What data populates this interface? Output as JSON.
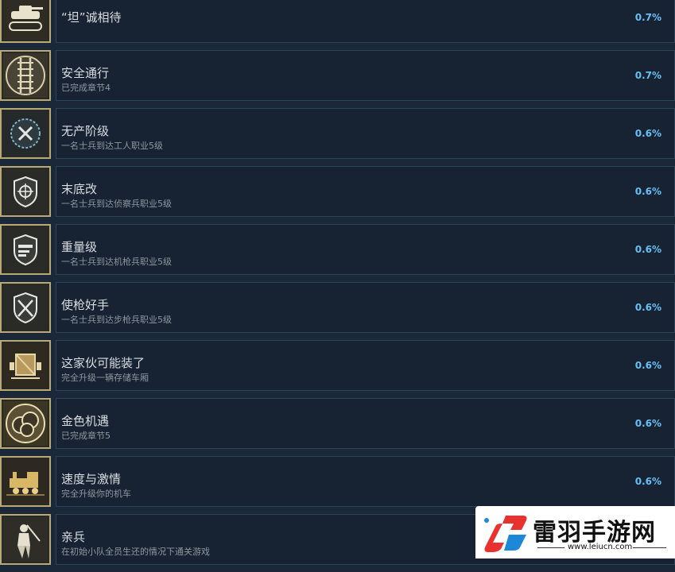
{
  "achievements": [
    {
      "title": "“坦”诚相待",
      "desc": "",
      "percent": "0.7%",
      "icon": "tank-icon"
    },
    {
      "title": "安全通行",
      "desc": "已完成章节4",
      "percent": "0.7%",
      "icon": "railroad-track-icon"
    },
    {
      "title": "无产阶级",
      "desc": "一名士兵到达工人职业5级",
      "percent": "0.6%",
      "icon": "wrench-screwdriver-badge-icon"
    },
    {
      "title": "末底改",
      "desc": "一名士兵到达侦察兵职业5级",
      "percent": "0.6%",
      "icon": "crosshair-shield-icon"
    },
    {
      "title": "重量级",
      "desc": "一名士兵到达机枪兵职业5级",
      "percent": "0.6%",
      "icon": "machine-gun-shield-icon"
    },
    {
      "title": "使枪好手",
      "desc": "一名士兵到达步枪兵职业5级",
      "percent": "0.6%",
      "icon": "crossed-rifles-shield-icon"
    },
    {
      "title": "这家伙可能装了",
      "desc": "完全升级一辆存储车厢",
      "percent": "0.6%",
      "icon": "cargo-crate-icon"
    },
    {
      "title": "金色机遇",
      "desc": "已完成章节5",
      "percent": "0.6%",
      "icon": "gold-coins-icon"
    },
    {
      "title": "速度与激情",
      "desc": "完全升级你的机车",
      "percent": "0.6%",
      "icon": "locomotive-icon"
    },
    {
      "title": "亲兵",
      "desc": "在初始小队全员生还的情况下通关游戏",
      "percent": "",
      "icon": "soldier-icon"
    }
  ],
  "watermark": {
    "text": "雷羽手游网",
    "url": "www.leiucn.com"
  }
}
